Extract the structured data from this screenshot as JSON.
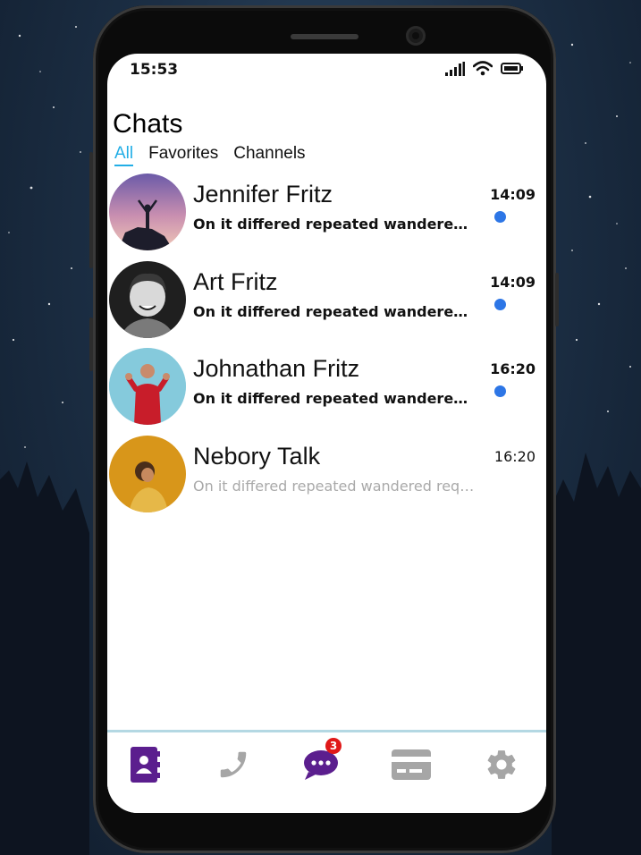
{
  "status_bar": {
    "time": "15:53"
  },
  "header": {
    "title": "Chats"
  },
  "tabs": [
    {
      "label": "All",
      "active": true
    },
    {
      "label": "Favorites",
      "active": false
    },
    {
      "label": "Channels",
      "active": false
    }
  ],
  "chats": [
    {
      "name": "Jennifer Fritz",
      "preview": "On it differed repeated wandered required in.",
      "time": "14:09",
      "unread": true
    },
    {
      "name": "Art Fritz",
      "preview": "On it differed repeated wandered required in.",
      "time": "14:09",
      "unread": true
    },
    {
      "name": "Johnathan Fritz",
      "preview": "On it differed repeated wandered required in.",
      "time": "16:20",
      "unread": true
    },
    {
      "name": "Nebory Talk",
      "preview": "On it differed repeated wandered required in.",
      "time": "16:20",
      "unread": false
    }
  ],
  "bottom_nav": {
    "items": [
      {
        "icon": "contacts-icon",
        "active": true
      },
      {
        "icon": "phone-icon",
        "active": false
      },
      {
        "icon": "chat-bubble-icon",
        "active": true
      },
      {
        "icon": "card-icon",
        "active": false
      },
      {
        "icon": "gear-icon",
        "active": false
      }
    ],
    "chat_badge": "3"
  },
  "colors": {
    "accent": "#22aee6",
    "unread_dot": "#2d76e6",
    "nav_active": "#5b1e8e",
    "nav_inactive": "#a6a6a6",
    "badge": "#e01818"
  }
}
